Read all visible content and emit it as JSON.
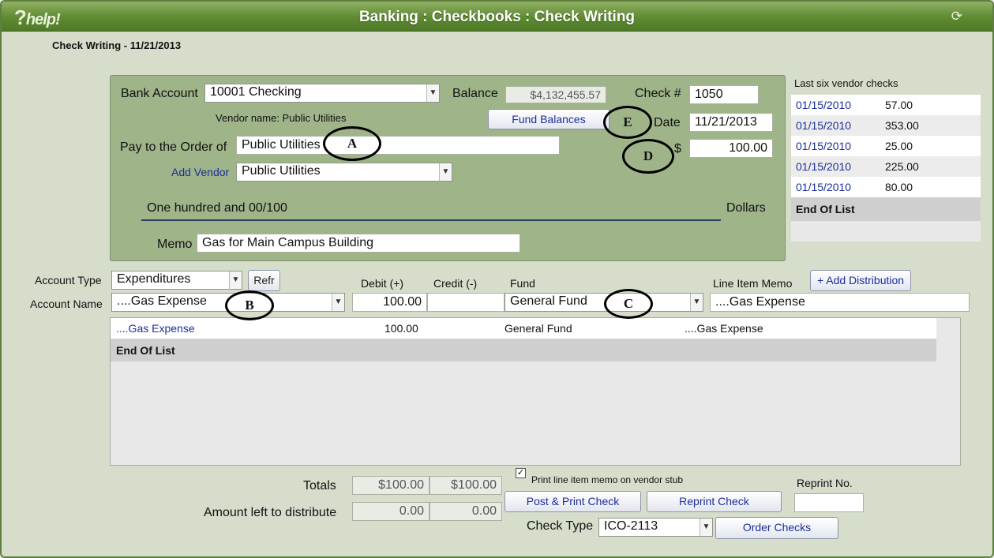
{
  "window": {
    "title": "Banking : Checkbooks : Check Writing",
    "help_label": "help!"
  },
  "page_heading": "Check Writing - 11/21/2013",
  "check": {
    "bank_account_label": "Bank Account",
    "bank_account_value": "10001 Checking",
    "balance_label": "Balance",
    "balance_value": "$4,132,455.57",
    "check_no_label": "Check #",
    "check_no_value": "1050",
    "vendor_name_text": "Vendor name: Public Utilities",
    "fund_balances_label": "Fund Balances",
    "date_label": "Date",
    "date_value": "11/21/2013",
    "pay_to_label": "Pay to the Order of",
    "pay_to_value": "Public Utilities",
    "dollar_sign": "$",
    "amount_value": "100.00",
    "add_vendor_label": "Add Vendor",
    "vendor_select_value": "Public Utilities",
    "amount_words": "One hundred and 00/100",
    "dollars_label": "Dollars",
    "memo_label": "Memo",
    "memo_value": "Gas for Main Campus Building"
  },
  "vendor_checks": {
    "title": "Last six vendor checks",
    "rows": [
      {
        "date": "01/15/2010",
        "amount": "57.00"
      },
      {
        "date": "01/15/2010",
        "amount": "353.00"
      },
      {
        "date": "01/15/2010",
        "amount": "25.00"
      },
      {
        "date": "01/15/2010",
        "amount": "225.00"
      },
      {
        "date": "01/15/2010",
        "amount": "80.00"
      }
    ],
    "end_label": "End Of List"
  },
  "distribution": {
    "account_type_label": "Account Type",
    "account_type_value": "Expenditures",
    "refresh_label": "Refr",
    "account_name_label": "Account Name",
    "account_name_value": "....Gas Expense",
    "debit_label": "Debit (+)",
    "debit_value": "100.00",
    "credit_label": "Credit (-)",
    "credit_value": "",
    "fund_label": "Fund",
    "fund_value": "General Fund",
    "line_memo_label": "Line Item Memo",
    "line_memo_value": "....Gas Expense",
    "add_distribution_label": "+ Add Distribution",
    "rows": [
      {
        "account": "....Gas Expense",
        "amount": "100.00",
        "fund": "General Fund",
        "memo": "....Gas Expense"
      }
    ],
    "end_label": "End Of List"
  },
  "footer": {
    "totals_label": "Totals",
    "total_debit": "$100.00",
    "total_credit": "$100.00",
    "left_label": "Amount left to distribute",
    "left_debit": "0.00",
    "left_credit": "0.00",
    "print_memo_label": "Print line item memo on vendor stub",
    "post_print_label": "Post & Print Check",
    "reprint_label": "Reprint Check",
    "reprint_no_label": "Reprint No.",
    "reprint_no_value": "",
    "check_type_label": "Check Type",
    "check_type_value": "ICO-2113",
    "order_checks_label": "Order Checks"
  },
  "annotations": {
    "a": "A",
    "b": "B",
    "c": "C",
    "d": "D",
    "e": "E"
  },
  "icons": {
    "help": "help-icon",
    "refresh": "refresh-icon",
    "close": "close-icon",
    "dropdown": "chevron-down-icon"
  }
}
